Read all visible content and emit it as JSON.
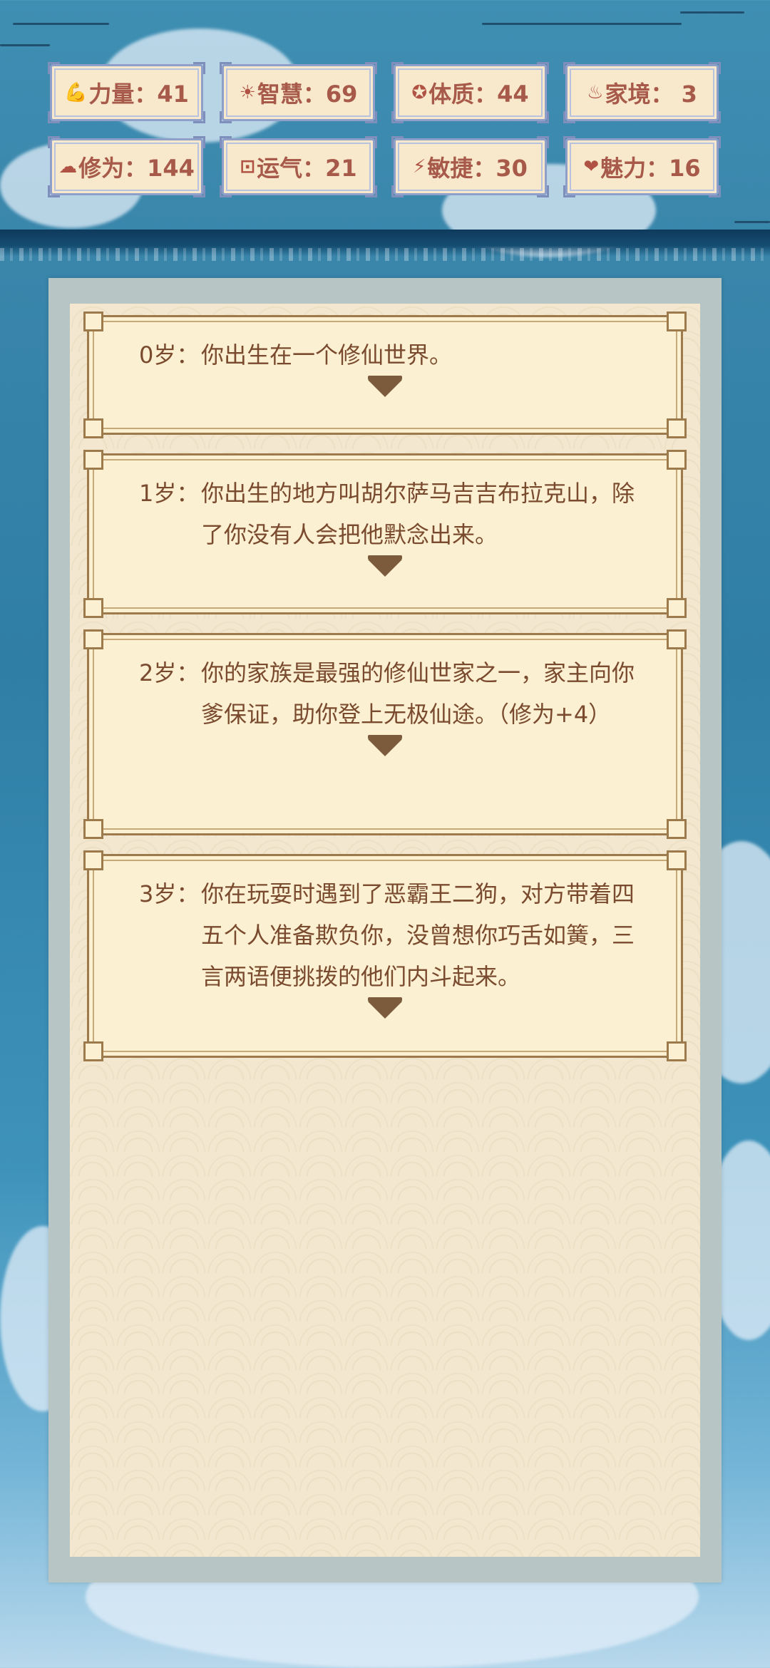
{
  "stats": [
    {
      "icon": "strength-icon",
      "glyph": "💪",
      "label": "力量：41"
    },
    {
      "icon": "wisdom-icon",
      "glyph": "☀",
      "label": "智慧：69"
    },
    {
      "icon": "constitution-icon",
      "glyph": "✪",
      "label": "体质：44"
    },
    {
      "icon": "family-icon",
      "glyph": "♨",
      "label": "家境： 3"
    },
    {
      "icon": "cultivation-icon",
      "glyph": "☁",
      "label": "修为：144"
    },
    {
      "icon": "luck-icon",
      "glyph": "⊡",
      "label": "运气：21"
    },
    {
      "icon": "agility-icon",
      "glyph": "⚡",
      "label": "敏捷：30"
    },
    {
      "icon": "charm-icon",
      "glyph": "❤",
      "label": "魅力：16"
    }
  ],
  "events": [
    {
      "age": "0岁：",
      "text": "你出生在一个修仙世界。"
    },
    {
      "age": "1岁：",
      "text": "你出生的地方叫胡尔萨马吉吉布拉克山，除了你没有人会把他默念出来。"
    },
    {
      "age": "2岁：",
      "text": "你的家族是最强的修仙世家之一，家主向你爹保证，助你登上无极仙途。（修为+4）"
    },
    {
      "age": "3岁：",
      "text": "你在玩耍时遇到了恶霸王二狗，对方带着四五个人准备欺负你，没曾想你巧舌如簧，三言两语便挑拨的他们内斗起来。"
    }
  ],
  "colors": {
    "stat_text": "#a85a4a",
    "stat_border": "#8ea0c9",
    "entry_text": "#7a4a2e",
    "entry_border": "#9c7a4c"
  }
}
